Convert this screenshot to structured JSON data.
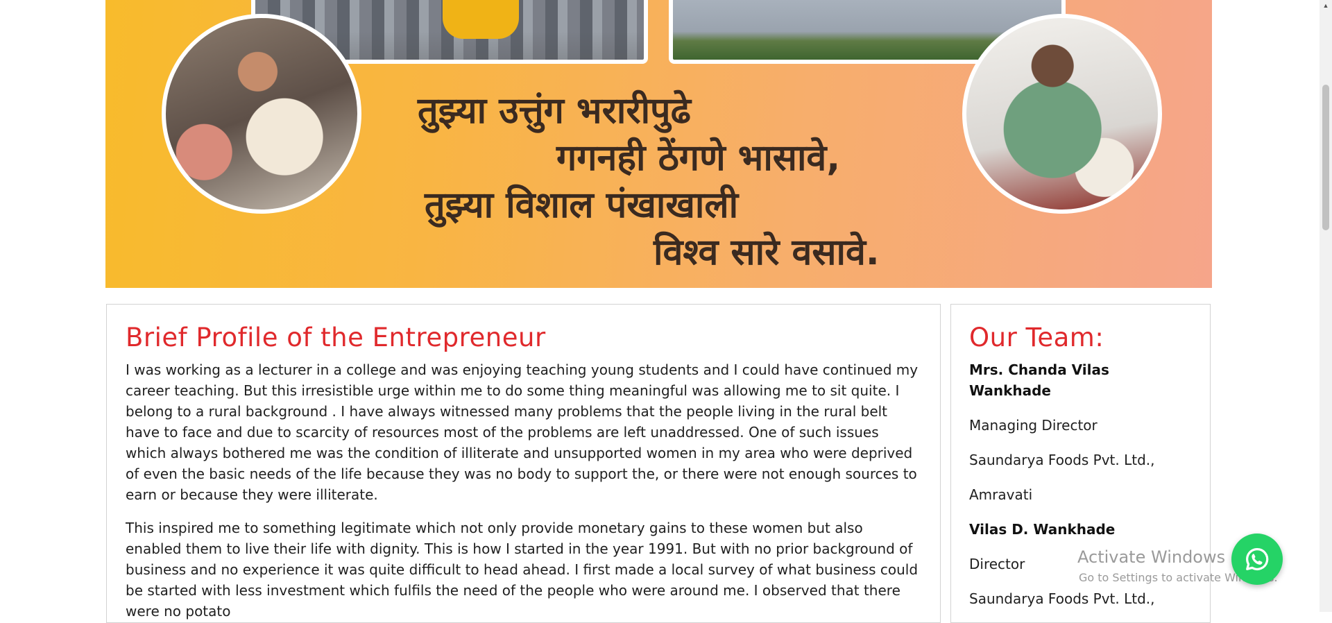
{
  "banner": {
    "verse_lines": [
      "तुझ्या उत्तुंग भरारीपुढे",
      "गगनही ठेंगणे भासावे,",
      "तुझ्या विशाल पंखाखाली",
      "विश्व सारे वसावे."
    ]
  },
  "profile": {
    "title": "Brief Profile of the Entrepreneur",
    "paragraphs": [
      "I was working as a lecturer in a college and was enjoying teaching young students and I could have continued my career teaching. But this irresistible urge within me to do some thing meaningful was allowing me to sit quite. I belong to a rural background . I have always witnessed many problems that the people living in the rural belt have to face and due to scarcity of resources most of the problems are left unaddressed. One of such issues which always bothered me was the condition of illiterate and unsupported women in my area who were deprived of even the basic needs of the life because they was no body to support the, or there were not enough sources to earn or because they were illiterate.",
      "This inspired me to something legitimate which not only provide monetary gains to these women but also enabled them to live their life with dignity. This is how I started in the year 1991. But with no prior background of business and no experience it was quite difficult to head ahead. I first made a local survey of what business could be started with less investment which fulfils the need of the people who were around me. I observed that there were no potato"
    ]
  },
  "team": {
    "title": "Our Team:",
    "lines": [
      {
        "text": "Mrs. Chanda Vilas Wankhade",
        "bold": true
      },
      {
        "text": "Managing Director",
        "bold": false
      },
      {
        "text": "Saundarya Foods Pvt. Ltd.,",
        "bold": false
      },
      {
        "text": "Amravati",
        "bold": false
      },
      {
        "text": "Vilas D. Wankhade",
        "bold": true
      },
      {
        "text": "Director",
        "bold": false
      },
      {
        "text": "Saundarya Foods Pvt. Ltd.,",
        "bold": false
      }
    ]
  },
  "watermark": {
    "title": "Activate Windows",
    "subtitle": "Go to Settings to activate Windows."
  },
  "icons": {
    "whatsapp": "whatsapp-icon",
    "scroll_up": "scroll-up-arrow-icon"
  },
  "colors": {
    "heading_red": "#e0292c",
    "whatsapp_green": "#25d366",
    "banner_gradient_start": "#f8bb2c",
    "banner_gradient_end": "#f6a58a"
  }
}
